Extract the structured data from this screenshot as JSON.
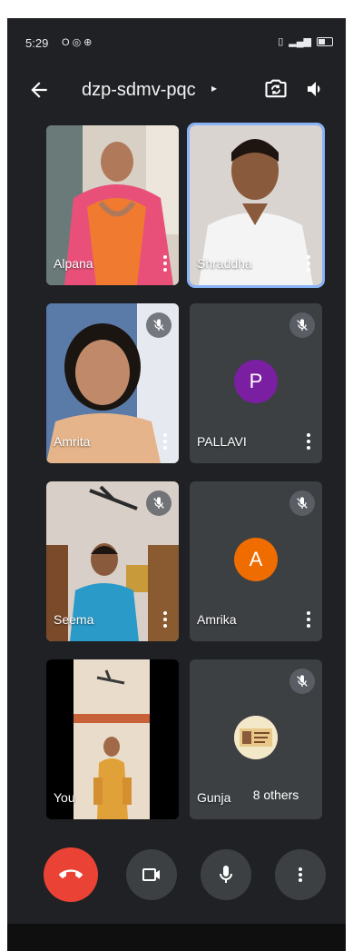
{
  "status_bar": {
    "time": "5:29",
    "notification_icons": [
      "signal-o-icon",
      "whatsapp-icon",
      "settings-icon"
    ],
    "right_icons": [
      "vibrate-icon",
      "network-icon",
      "battery-icon"
    ]
  },
  "header": {
    "meeting_code": "dzp-sdmv-pqc",
    "caret": "▸"
  },
  "participants": [
    {
      "name": "Alpana",
      "has_video": true,
      "muted": false,
      "selected": false
    },
    {
      "name": "Shraddha",
      "has_video": true,
      "muted": false,
      "selected": true
    },
    {
      "name": "Amrita",
      "has_video": true,
      "muted": true,
      "selected": false
    },
    {
      "name": "PALLAVI",
      "has_video": false,
      "avatar_letter": "P",
      "avatar_color": "#7b1fa2",
      "muted": true
    },
    {
      "name": "Seema",
      "has_video": true,
      "muted": true
    },
    {
      "name": "Amrika",
      "has_video": false,
      "avatar_letter": "A",
      "avatar_color": "#ef6c00",
      "muted": true
    },
    {
      "name": "You",
      "has_video": true,
      "muted": false
    },
    {
      "name": "Gunja",
      "has_video": false,
      "muted": true,
      "avatar_image": "certificate-photo"
    }
  ],
  "others_chip": "8 others",
  "controls": {
    "end_call_color": "#ea4335",
    "items": [
      "end-call-icon",
      "camera-icon",
      "microphone-icon",
      "more-options-icon"
    ]
  },
  "colors": {
    "background": "#202124",
    "tile": "#3c4043",
    "selected_outline": "#8ab4f8"
  }
}
